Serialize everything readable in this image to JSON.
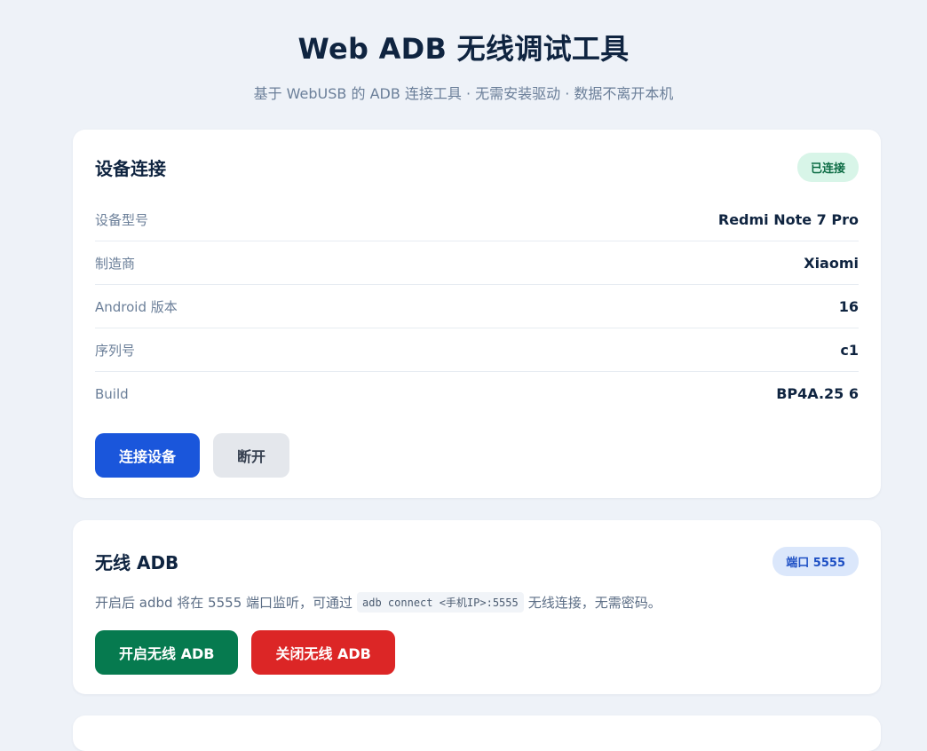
{
  "header": {
    "title": "Web ADB 无线调试工具",
    "subtitle": "基于 WebUSB 的 ADB 连接工具 · 无需安装驱动 · 数据不离开本机"
  },
  "device_card": {
    "title": "设备连接",
    "status_badge": "已连接",
    "rows": [
      {
        "label": "设备型号",
        "value": "Redmi Note 7 Pro"
      },
      {
        "label": "制造商",
        "value": "Xiaomi"
      },
      {
        "label": "Android 版本",
        "value": "16"
      },
      {
        "label": "序列号",
        "value": "c1"
      },
      {
        "label": "Build",
        "value": "BP4A.25  6"
      }
    ],
    "connect_label": "连接设备",
    "disconnect_label": "断开"
  },
  "wireless_card": {
    "title": "无线 ADB",
    "port_badge": "端口 5555",
    "desc_before": "开启后 adbd 将在 5555 端口监听，可通过",
    "desc_code": "adb connect <手机IP>:5555",
    "desc_after": "无线连接，无需密码。",
    "enable_label": "开启无线 ADB",
    "disable_label": "关闭无线 ADB"
  }
}
